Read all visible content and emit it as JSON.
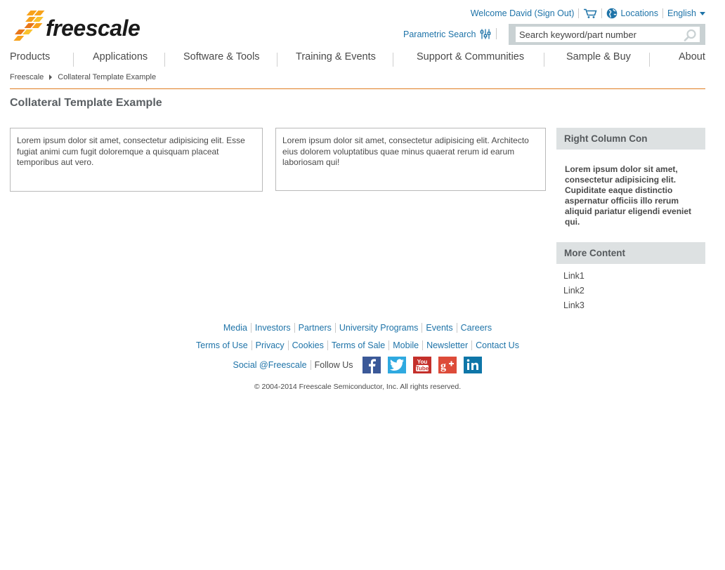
{
  "header": {
    "logo_text": "freescale",
    "welcome": "Welcome David (Sign Out)",
    "locations": "Locations",
    "language": "English",
    "parametric_search": "Parametric Search",
    "search_placeholder": "Search keyword/part number"
  },
  "nav": {
    "items": [
      "Products",
      "Applications",
      "Software & Tools",
      "Training & Events",
      "Support & Communities",
      "Sample & Buy",
      "About"
    ]
  },
  "breadcrumb": {
    "items": [
      "Freescale",
      "Collateral Template Example"
    ]
  },
  "page": {
    "title": "Collateral Template Example",
    "card1": "Lorem ipsum dolor sit amet, consectetur adipisicing elit. Esse fugiat animi cum fugit doloremque a quisquam placeat temporibus aut vero.",
    "card2": "Lorem ipsum dolor sit amet, consectetur adipisicing elit. Architecto eius dolorem voluptatibus quae minus quaerat rerum id earum laboriosam qui!"
  },
  "right_column": {
    "heading1": "Right Column Con",
    "body": "Lorem ipsum dolor sit amet, consectetur adipisicing elit. Cupiditate eaque distinctio aspernatur officiis illo rerum aliquid pariatur eligendi eveniet qui.",
    "heading2": "More Content",
    "links": [
      "Link1",
      "Link2",
      "Link3"
    ]
  },
  "footer": {
    "row1": [
      "Media",
      "Investors",
      "Partners",
      "University Programs",
      "Events",
      "Careers"
    ],
    "row2": [
      "Terms of Use",
      "Privacy",
      "Cookies",
      "Terms of Sale",
      "Mobile",
      "Newsletter",
      "Contact Us"
    ],
    "social_label": "Social @Freescale",
    "follow_label": "Follow Us",
    "social_icons": [
      "facebook-icon",
      "twitter-icon",
      "youtube-icon",
      "google-plus-icon",
      "linkedin-icon"
    ],
    "copyright": "© 2004-2014 Freescale Semiconductor, Inc. All rights reserved."
  },
  "colors": {
    "link": "#1e73a8",
    "accent_orange": "#e07c21",
    "panel_gray": "#dde1e2",
    "search_frame": "#c9d1d3"
  }
}
